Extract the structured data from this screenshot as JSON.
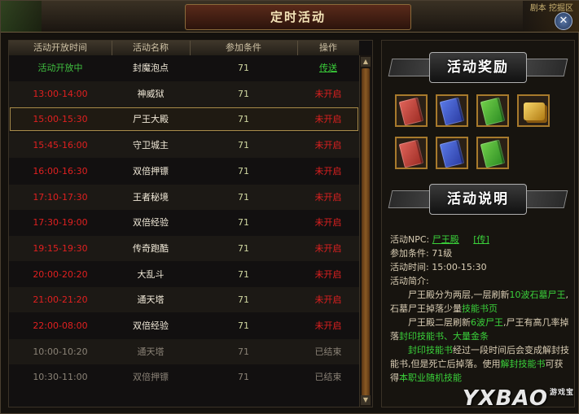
{
  "window": {
    "title": "定时活动",
    "corner_text": "剧本  挖掘区",
    "close_symbol": "✕"
  },
  "table": {
    "headers": [
      "活动开放时间",
      "活动名称",
      "参加条件",
      "操作"
    ],
    "rows": [
      {
        "time": "活动开放中",
        "name": "封魔泡点",
        "cond": "71",
        "action": "传送",
        "time_color": "green",
        "action_type": "link"
      },
      {
        "time": "13:00-14:00",
        "name": "神威狱",
        "cond": "71",
        "action": "未开启",
        "time_color": "red",
        "action_type": "red"
      },
      {
        "time": "15:00-15:30",
        "name": "尸王大殿",
        "cond": "71",
        "action": "未开启",
        "time_color": "red",
        "action_type": "red",
        "selected": true
      },
      {
        "time": "15:45-16:00",
        "name": "守卫城主",
        "cond": "71",
        "action": "未开启",
        "time_color": "red",
        "action_type": "red"
      },
      {
        "time": "16:00-16:30",
        "name": "双倍押镖",
        "cond": "71",
        "action": "未开启",
        "time_color": "red",
        "action_type": "red"
      },
      {
        "time": "17:10-17:30",
        "name": "王者秘境",
        "cond": "71",
        "action": "未开启",
        "time_color": "red",
        "action_type": "red"
      },
      {
        "time": "17:30-19:00",
        "name": "双倍经验",
        "cond": "71",
        "action": "未开启",
        "time_color": "red",
        "action_type": "red"
      },
      {
        "time": "19:15-19:30",
        "name": "传奇跑酷",
        "cond": "71",
        "action": "未开启",
        "time_color": "red",
        "action_type": "red"
      },
      {
        "time": "20:00-20:20",
        "name": "大乱斗",
        "cond": "71",
        "action": "未开启",
        "time_color": "red",
        "action_type": "red"
      },
      {
        "time": "21:00-21:20",
        "name": "通天塔",
        "cond": "71",
        "action": "未开启",
        "time_color": "red",
        "action_type": "red"
      },
      {
        "time": "22:00-08:00",
        "name": "双倍经验",
        "cond": "71",
        "action": "未开启",
        "time_color": "red",
        "action_type": "red"
      },
      {
        "time": "10:00-10:20",
        "name": "通天塔",
        "cond": "71",
        "action": "已结束",
        "time_color": "gray",
        "action_type": "gray",
        "ended": true
      },
      {
        "time": "10:30-11:00",
        "name": "双倍押镖",
        "cond": "71",
        "action": "已结束",
        "time_color": "gray",
        "action_type": "gray",
        "ended": true
      }
    ],
    "scroll_up": "▲",
    "scroll_down": "▼"
  },
  "rewards": {
    "banner_title": "活动奖励",
    "items": [
      {
        "icon": "red-skill-book-icon",
        "color": "red"
      },
      {
        "icon": "blue-skill-book-icon",
        "color": "blue"
      },
      {
        "icon": "green-skill-book-icon",
        "color": "green"
      },
      {
        "icon": "gold-bars-icon",
        "color": "gold"
      },
      {
        "icon": "red-skill-book-icon",
        "color": "red"
      },
      {
        "icon": "blue-skill-book-icon",
        "color": "blue"
      },
      {
        "icon": "green-skill-book-icon",
        "color": "green"
      }
    ]
  },
  "description": {
    "banner_title": "活动说明",
    "npc_label": "活动NPC:",
    "npc_name": "尸王殿",
    "npc_link": "[传]",
    "cond_label": "参加条件:",
    "cond_value": "71级",
    "time_label": "活动时间:",
    "time_value": "15:00-15:30",
    "intro_label": "活动简介:",
    "p1_a": "尸王殿分为两层,一层刷新",
    "p1_b": "10波石墓",
    "p1_c": "尸王",
    "p1_d": ",石墓尸王掉落少量",
    "p1_e": "技能书页",
    "p2_a": "尸王殿二层刷新",
    "p2_b": "6波尸王",
    "p2_c": ",尸王有高几率掉落",
    "p2_d": "封印技能书、大量金条",
    "p3_a": "封印技能书",
    "p3_b": "经过一段时间后会变成解封技能书,但是死亡后掉落。使用",
    "p3_c": "解封技能书",
    "p3_d": "可获得",
    "p3_e": "本职业随机技能"
  },
  "watermark": {
    "text": "YXBAO",
    "sub": "游戏宝"
  }
}
